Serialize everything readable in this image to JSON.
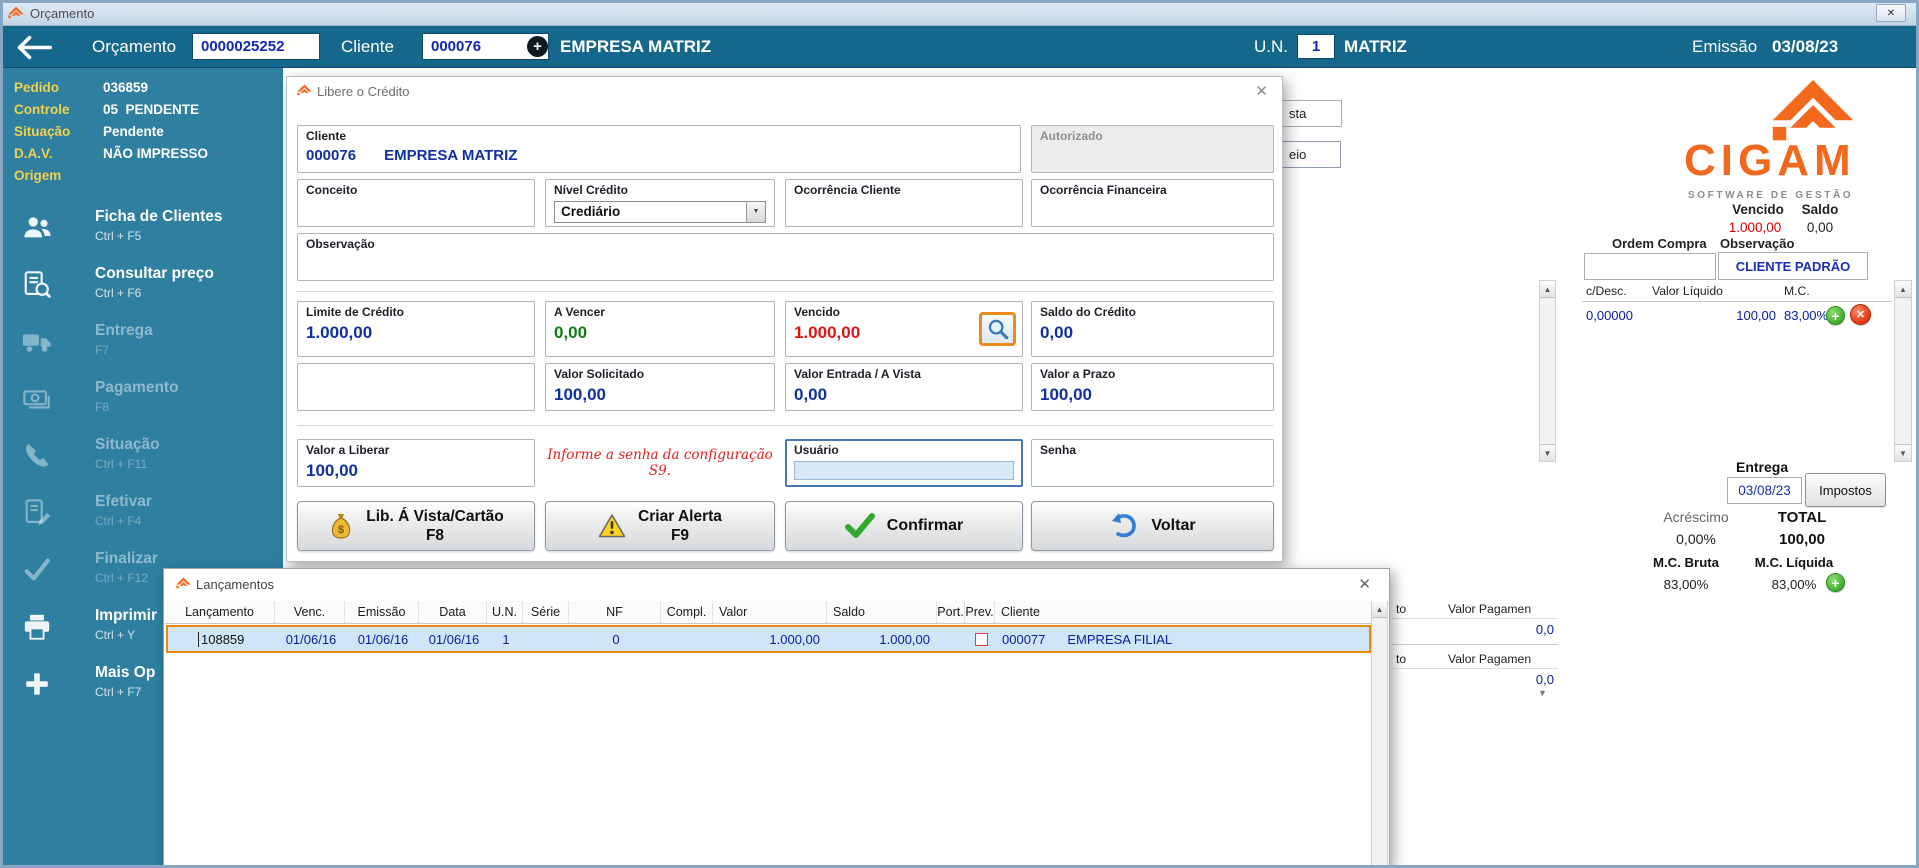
{
  "icons": {
    "close": "✕",
    "dropdown": "▼",
    "scroll_up": "▲",
    "scroll_down": "▼",
    "plus": "+",
    "x_mark": "✕"
  },
  "window": {
    "title": "Orçamento"
  },
  "header": {
    "orcamento_label": "Orçamento",
    "orcamento_value": "0000025252",
    "cliente_label": "Cliente",
    "cliente_value": "000076",
    "cliente_name": "EMPRESA MATRIZ",
    "un_label": "U.N.",
    "un_value": "1",
    "un_name": "MATRIZ",
    "emissao_label": "Emissão",
    "emissao_value": "03/08/23"
  },
  "sidebar": {
    "info": [
      {
        "label": "Pedido",
        "value": "036859"
      },
      {
        "label": "Controle",
        "value": "05  PENDENTE"
      },
      {
        "label": "Situação",
        "value": "Pendente"
      },
      {
        "label": "D.A.V.",
        "value": "NÃO IMPRESSO"
      },
      {
        "label": "Origem",
        "value": ""
      }
    ],
    "menu": [
      {
        "label": "Ficha de Clientes",
        "shortcut": "Ctrl + F5"
      },
      {
        "label": "Consultar preço",
        "shortcut": "Ctrl + F6"
      },
      {
        "label": "Entrega",
        "shortcut": "F7"
      },
      {
        "label": "Pagamento",
        "shortcut": "F8"
      },
      {
        "label": "Situação",
        "shortcut": "Ctrl + F11"
      },
      {
        "label": "Efetivar",
        "shortcut": "Ctrl + F4"
      },
      {
        "label": "Finalizar",
        "shortcut": "Ctrl + F12"
      },
      {
        "label": "Imprimir",
        "shortcut": "Ctrl + Y"
      },
      {
        "label": "Mais Op",
        "shortcut": "Ctrl + F7"
      }
    ]
  },
  "modal": {
    "title": "Libere o Crédito",
    "f": {
      "cliente_label": "Cliente",
      "cliente_code": "000076",
      "cliente_name": "EMPRESA MATRIZ",
      "autorizado_label": "Autorizado",
      "conceito_label": "Conceito",
      "nivel_label": "Nível Crédito",
      "nivel_value": "Crediário",
      "ocorr_cliente_label": "Ocorrência Cliente",
      "ocorr_fin_label": "Ocorrência Financeira",
      "observacao_label": "Observação",
      "limite_label": "Limite de Crédito",
      "limite_value": "1.000,00",
      "a_vencer_label": "A Vencer",
      "a_vencer_value": "0,00",
      "vencido_label": "Vencido",
      "vencido_value": "1.000,00",
      "saldo_label": "Saldo do Crédito",
      "saldo_value": "0,00",
      "solicitado_label": "Valor Solicitado",
      "solicitado_value": "100,00",
      "entrada_label": "Valor Entrada / A Vista",
      "entrada_value": "0,00",
      "prazo_label": "Valor a Prazo",
      "prazo_value": "100,00",
      "liberar_label": "Valor a Liberar",
      "liberar_value": "100,00",
      "senha_hint": "Informe a senha da configuração S9.",
      "usuario_label": "Usuário",
      "senha_label": "Senha"
    },
    "btn": {
      "lib_vista_label": "Lib. Á Vista/Cartão",
      "lib_vista_key": "F8",
      "alerta_label": "Criar Alerta",
      "alerta_key": "F9",
      "confirmar_label": "Confirmar",
      "voltar_label": "Voltar"
    }
  },
  "lancamentos": {
    "title": "Lançamentos",
    "columns": [
      "Lançamento",
      "Venc.",
      "Emissão",
      "Data",
      "U.N.",
      "Série",
      "NF",
      "Compl.",
      "Valor",
      "Saldo",
      "Port.",
      "Prev.",
      "Cliente"
    ],
    "row": {
      "lancamento": "108859",
      "venc": "01/06/16",
      "emissao": "01/06/16",
      "data": "01/06/16",
      "un": "1",
      "serie": "",
      "nf": "0",
      "compl": "",
      "valor": "1.000,00",
      "saldo": "1.000,00",
      "port": "",
      "cliente_code": "000077",
      "cliente_name": "EMPRESA FILIAL"
    }
  },
  "rp": {
    "brand": "CIGAM",
    "brand_tagline": "SOFTWARE DE GESTÃO",
    "vencido_label": "Vencido",
    "vencido_value": "1.000,00",
    "saldo_label": "Saldo",
    "saldo_value": "0,00",
    "ordem_compra_label": "Ordem Compra",
    "observacao_label": "Observação",
    "cliente_padrao": "CLIENTE PADRÃO",
    "frag_vista": "sta",
    "frag_meio": "eio",
    "grid_col1": "c/Desc.",
    "grid_col2": "Valor Líquido",
    "grid_col3": "M.C.",
    "grid_v1": "0,00000",
    "grid_v2": "100,00",
    "grid_v3": "83,00%",
    "entrega_label": "Entrega",
    "entrega_value": "03/08/23",
    "impostos_label": "Impostos",
    "acrescimo_label": "Acréscimo",
    "acrescimo_value": "0,00%",
    "total_label": "TOTAL",
    "total_value": "100,00",
    "mc_bruta_label": "M.C. Bruta",
    "mc_bruta_value": "83,00%",
    "mc_liquida_label": "M.C. Líquida",
    "mc_liquida_value": "83,00%",
    "pay1_col1": "to",
    "pay1_col2": "Valor Pagamen",
    "pay1_value": "0,0",
    "pay2_col1": "to",
    "pay2_col2": "Valor Pagamen",
    "pay2_value": "0,0"
  }
}
